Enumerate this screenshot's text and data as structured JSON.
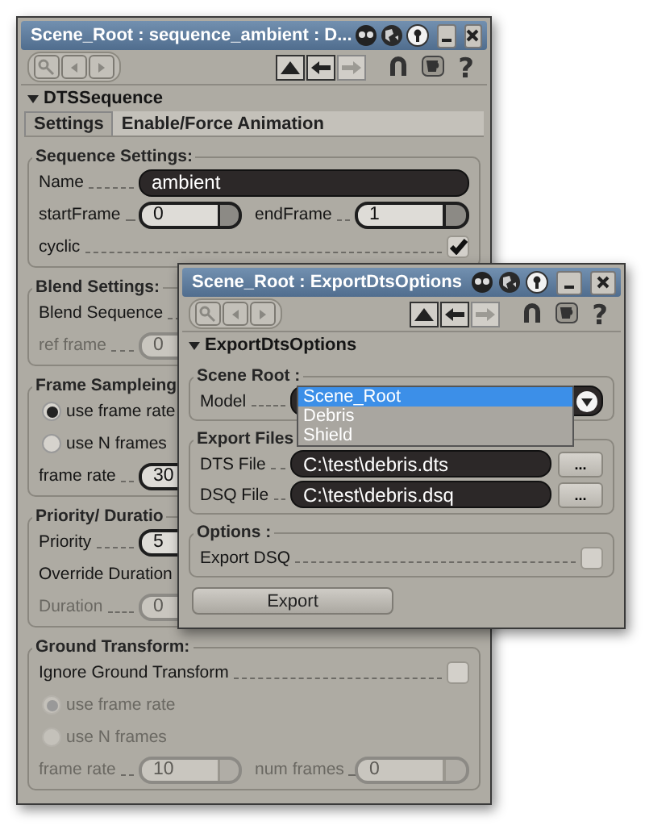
{
  "back_window": {
    "title": "Scene_Root : sequence_ambient : D...",
    "help": "?",
    "section": {
      "label": "DTSSequence",
      "expanded": true
    },
    "tabs": [
      {
        "label": "Settings",
        "selected": true
      },
      {
        "label": "Enable/Force Animation",
        "selected": false
      }
    ],
    "groups": [
      {
        "title": "Sequence Settings:",
        "rows": [
          {
            "kind": "text",
            "label": "Name",
            "value": "ambient"
          },
          {
            "kind": "numbers",
            "fields": [
              {
                "label": "startFrame",
                "value": "0",
                "disabled": false
              },
              {
                "label": "endFrame",
                "value": "1",
                "disabled": false
              }
            ]
          },
          {
            "kind": "check",
            "label": "cyclic",
            "checked": true,
            "disabled": false
          }
        ]
      },
      {
        "title": "Blend Settings:",
        "rows": [
          {
            "kind": "label",
            "label": "Blend Sequence"
          },
          {
            "kind": "numbers",
            "fields": [
              {
                "label": "ref frame",
                "value": "0",
                "disabled": true
              }
            ]
          }
        ]
      },
      {
        "title": "Frame Sampleing",
        "rows": [
          {
            "kind": "radio",
            "label": "use frame rate",
            "selected": true,
            "disabled": false
          },
          {
            "kind": "radio",
            "label": "use N frames",
            "selected": false,
            "disabled": false
          },
          {
            "kind": "numbers",
            "fields": [
              {
                "label": "frame rate",
                "value": "30",
                "disabled": false
              }
            ]
          }
        ]
      },
      {
        "title": "Priority/ Duratio",
        "rows": [
          {
            "kind": "numbers",
            "fields": [
              {
                "label": "Priority",
                "value": "5",
                "disabled": false
              }
            ]
          },
          {
            "kind": "label",
            "label": "Override Duration"
          },
          {
            "kind": "numbers",
            "fields": [
              {
                "label": "Duration",
                "value": "0",
                "disabled": true
              }
            ]
          }
        ]
      },
      {
        "title": "Ground Transform:",
        "rows": [
          {
            "kind": "check",
            "label": "Ignore Ground Transform",
            "checked": false,
            "disabled": false
          },
          {
            "kind": "radio",
            "label": "use frame rate",
            "selected": true,
            "disabled": true
          },
          {
            "kind": "radio",
            "label": "use N frames",
            "selected": false,
            "disabled": true
          },
          {
            "kind": "numbers",
            "fields": [
              {
                "label": "frame rate",
                "value": "10",
                "disabled": true
              },
              {
                "label": "num frames",
                "value": "0",
                "disabled": true
              }
            ]
          }
        ]
      }
    ]
  },
  "front_window": {
    "title": "Scene_Root : ExportDtsOptions",
    "help": "?",
    "section": {
      "label": "ExportDtsOptions",
      "expanded": true
    },
    "groups": [
      {
        "title": "Scene Root :",
        "rows": [
          {
            "kind": "combo",
            "label": "Model",
            "expanded": true,
            "options": [
              {
                "label": "Scene_Root",
                "selected": true
              },
              {
                "label": "Debris",
                "selected": false
              },
              {
                "label": "Shield",
                "selected": false
              }
            ]
          }
        ]
      },
      {
        "title": "Export Files",
        "rows": [
          {
            "kind": "file",
            "label": "DTS File",
            "value": "C:\\test\\debris.dts",
            "button": "..."
          },
          {
            "kind": "file",
            "label": "DSQ File",
            "value": "C:\\test\\debris.dsq",
            "button": "..."
          }
        ]
      },
      {
        "title": "Options :",
        "rows": [
          {
            "kind": "check",
            "label": "Export DSQ",
            "checked": false,
            "disabled": false
          }
        ]
      }
    ],
    "action": "Export"
  }
}
